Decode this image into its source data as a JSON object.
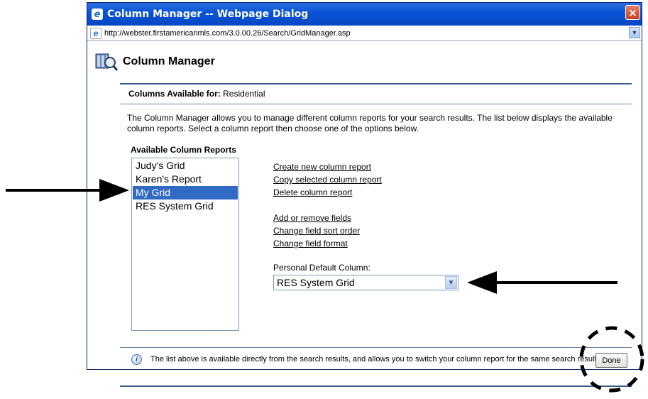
{
  "window": {
    "title": "Column Manager -- Webpage Dialog",
    "url": "http://webster.firstamericanmls.com/3.0.00.26/Search/GridManager.asp",
    "close_label": "×"
  },
  "page": {
    "title": "Column Manager",
    "columns_available_label": "Columns Available for:",
    "columns_available_value": "Residential",
    "description": "The Column Manager allows you to manage different column reports for your search results. The list below displays the available column reports. Select a column report then choose one of the options below."
  },
  "reports": {
    "label": "Available Column Reports",
    "items": [
      {
        "label": "Judy's Grid",
        "selected": false
      },
      {
        "label": "Karen's Report",
        "selected": false
      },
      {
        "label": "My Grid",
        "selected": true
      },
      {
        "label": "RES System Grid",
        "selected": false
      }
    ]
  },
  "actions": {
    "create": "Create new column report",
    "copy": "Copy selected column report",
    "delete": "Delete column report",
    "add_remove": "Add or remove fields",
    "sort_order": "Change field sort order",
    "format": "Change field format"
  },
  "personal_default": {
    "label": "Personal Default Column:",
    "value": "RES System Grid"
  },
  "info": {
    "text": "The list above is available directly from the search results, and allows you to switch your column report for the same search results."
  },
  "buttons": {
    "done": "Done"
  },
  "colors": {
    "titlebar": "#0a55d6",
    "selection": "#316ac5",
    "rule": "#3a5a8a"
  }
}
